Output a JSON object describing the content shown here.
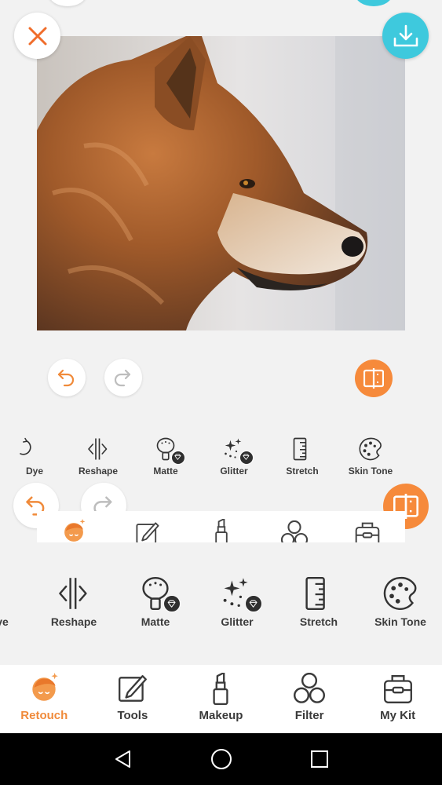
{
  "top_bar": {
    "close_icon": "close-icon",
    "download_icon": "download-icon"
  },
  "photo": {
    "subject": "wolf-profile-photo"
  },
  "history": {
    "undo_icon": "undo-icon",
    "redo_icon": "redo-icon",
    "compare_icon": "compare-icon"
  },
  "tools": [
    {
      "id": "dye",
      "label": "Dye",
      "icon": "dye-icon"
    },
    {
      "id": "reshape",
      "label": "Reshape",
      "icon": "reshape-icon"
    },
    {
      "id": "matte",
      "label": "Matte",
      "icon": "matte-icon",
      "premium": true
    },
    {
      "id": "glitter",
      "label": "Glitter",
      "icon": "glitter-icon",
      "premium": true
    },
    {
      "id": "stretch",
      "label": "Stretch",
      "icon": "stretch-icon"
    },
    {
      "id": "skin-tone",
      "label": "Skin Tone",
      "icon": "skin-tone-icon"
    }
  ],
  "tabs": [
    {
      "id": "retouch",
      "label": "Retouch",
      "icon": "retouch-icon",
      "active": true
    },
    {
      "id": "tools",
      "label": "Tools",
      "icon": "tools-icon",
      "active": false
    },
    {
      "id": "makeup",
      "label": "Makeup",
      "icon": "makeup-icon",
      "active": false
    },
    {
      "id": "filter",
      "label": "Filter",
      "icon": "filter-icon",
      "active": false
    },
    {
      "id": "my-kit",
      "label": "My Kit",
      "icon": "my-kit-icon",
      "active": false
    }
  ],
  "colors": {
    "accent": "#f68a3b",
    "download": "#3ec9dd",
    "active_tab": "#f08a3a",
    "background": "#f2f2f2",
    "nav_bar": "#000000"
  },
  "nav": {
    "back_icon": "back-icon",
    "home_icon": "home-icon",
    "recents_icon": "recents-icon"
  }
}
